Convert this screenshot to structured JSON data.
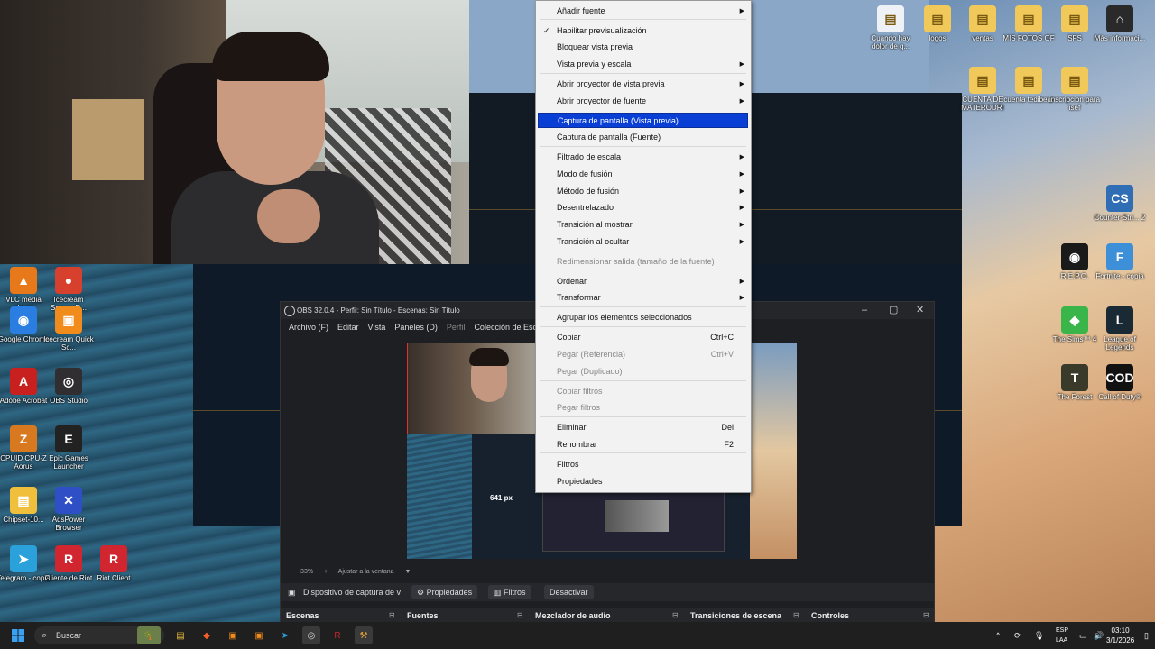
{
  "context_menu": {
    "items": [
      {
        "label": "Añadir fuente",
        "submenu": true
      },
      {
        "sep": true
      },
      {
        "label": "Habilitar previsualización",
        "checked": true
      },
      {
        "label": "Bloquear vista previa"
      },
      {
        "label": "Vista previa y escala",
        "submenu": true
      },
      {
        "sep": true
      },
      {
        "label": "Abrir proyector de vista previa",
        "submenu": true
      },
      {
        "label": "Abrir proyector de fuente",
        "submenu": true
      },
      {
        "label": "Captura de pantalla (Vista previa)",
        "selected": true
      },
      {
        "label": "Captura de pantalla (Fuente)"
      },
      {
        "sep": true
      },
      {
        "label": "Filtrado de escala",
        "submenu": true
      },
      {
        "label": "Modo de fusión",
        "submenu": true
      },
      {
        "label": "Método de fusión",
        "submenu": true
      },
      {
        "label": "Desentrelazado",
        "submenu": true
      },
      {
        "label": "Transición al mostrar",
        "submenu": true
      },
      {
        "label": "Transición al ocultar",
        "submenu": true
      },
      {
        "sep": true
      },
      {
        "label": "Redimensionar salida (tamaño de la fuente)",
        "disabled": true
      },
      {
        "sep": true
      },
      {
        "label": "Ordenar",
        "submenu": true
      },
      {
        "label": "Transformar",
        "submenu": true
      },
      {
        "sep": true
      },
      {
        "label": "Agrupar los elementos seleccionados"
      },
      {
        "sep": true
      },
      {
        "label": "Copiar",
        "shortcut": "Ctrl+C"
      },
      {
        "label": "Pegar (Referencia)",
        "shortcut": "Ctrl+V",
        "disabled": true
      },
      {
        "label": "Pegar (Duplicado)",
        "disabled": true
      },
      {
        "sep": true
      },
      {
        "label": "Copiar filtros",
        "disabled": true
      },
      {
        "label": "Pegar filtros",
        "disabled": true
      },
      {
        "sep": true
      },
      {
        "label": "Eliminar",
        "shortcut": "Del"
      },
      {
        "label": "Renombrar",
        "shortcut": "F2"
      },
      {
        "sep": true
      },
      {
        "label": "Filtros"
      },
      {
        "label": "Propiedades"
      }
    ]
  },
  "obs": {
    "title": "OBS 32.0.4 - Perfil: Sin Título - Escenas: Sin Título",
    "menu": [
      "Archivo (F)",
      "Editar",
      "Vista",
      "Paneles (D)",
      "Perfil",
      "Colección de Escena"
    ],
    "preview_label": "641 px",
    "zoom": "33%",
    "zoom_fit": "Ajustar a la ventana",
    "source_name": "Dispositivo de captura de v",
    "btn_properties": "Propiedades",
    "btn_filters": "Filtros",
    "btn_deactivate": "Desactivar",
    "docks": [
      "Escenas",
      "Fuentes",
      "Mezclador de audio",
      "Transiciones de escena",
      "Controles"
    ]
  },
  "desktop_left": [
    {
      "label": "VLC media player",
      "color": "#e8791b",
      "glyph": "▲"
    },
    {
      "label": "Icecream Screen R...",
      "color": "#d6402d",
      "glyph": "●"
    },
    {
      "label": "Google Chrome",
      "color": "#2a7de1",
      "glyph": "◉"
    },
    {
      "label": "Icecream Quick Sc...",
      "color": "#f08b1c",
      "glyph": "▣"
    },
    {
      "label": "Adobe Acrobat",
      "color": "#c8201e",
      "glyph": "A"
    },
    {
      "label": "OBS Studio",
      "color": "#302e31",
      "glyph": "◎"
    },
    {
      "label": "CPUID CPU-Z Aorus",
      "color": "#d9791f",
      "glyph": "Z"
    },
    {
      "label": "Epic Games Launcher",
      "color": "#222",
      "glyph": "E"
    },
    {
      "label": "Chipset-10...",
      "color": "#f0c03c",
      "glyph": "▤"
    },
    {
      "label": "AdsPower Browser",
      "color": "#2f4fc7",
      "glyph": "✕"
    },
    {
      "label": "Telegram - copia",
      "color": "#2aa1da",
      "glyph": "➤"
    },
    {
      "label": "Cliente de Riot",
      "color": "#d1252f",
      "glyph": "R"
    },
    {
      "label": "Riot Client",
      "color": "#d1252f",
      "glyph": "R"
    }
  ],
  "desktop_right": [
    {
      "label": "Cuando hay dolor de g...",
      "color": "#eef1f5",
      "glyph": "▤"
    },
    {
      "label": "logos",
      "color": "#f0c95a",
      "glyph": "▤"
    },
    {
      "label": "ventas",
      "color": "#f0c95a",
      "glyph": "▤"
    },
    {
      "label": "MIS FOTOS OF",
      "color": "#f0c95a",
      "glyph": "▤"
    },
    {
      "label": "SFS",
      "color": "#f0c95a",
      "glyph": "▤"
    },
    {
      "label": "Más informaci...",
      "color": "#2a2a2a",
      "glyph": "⌂"
    },
    {
      "label": "CUENTA DE MATERODRI",
      "color": "#f0c95a",
      "glyph": "▤"
    },
    {
      "label": "cuenta tedibear",
      "color": "#f0c95a",
      "glyph": "▤"
    },
    {
      "label": "inscripcion para isef",
      "color": "#f0c95a",
      "glyph": "▤"
    },
    {
      "label": "Counter-Stri... 2",
      "color": "#2f6db5",
      "glyph": "CS"
    },
    {
      "label": "R.E.P.O.",
      "color": "#1a1a1a",
      "glyph": "◉"
    },
    {
      "label": "Fortnite - copia",
      "color": "#3d8fd8",
      "glyph": "F"
    },
    {
      "label": "The Sims™ 4",
      "color": "#3ab54a",
      "glyph": "◆"
    },
    {
      "label": "League of Legends",
      "color": "#1a2a34",
      "glyph": "L"
    },
    {
      "label": "The Forest",
      "color": "#3a3a2a",
      "glyph": "T"
    },
    {
      "label": "Call of Duty®",
      "color": "#111",
      "glyph": "COD"
    }
  ],
  "taskbar": {
    "search_placeholder": "Buscar",
    "lang_1": "ESP",
    "lang_2": "LAA",
    "time": "03:10",
    "date": "3/1/2026"
  }
}
